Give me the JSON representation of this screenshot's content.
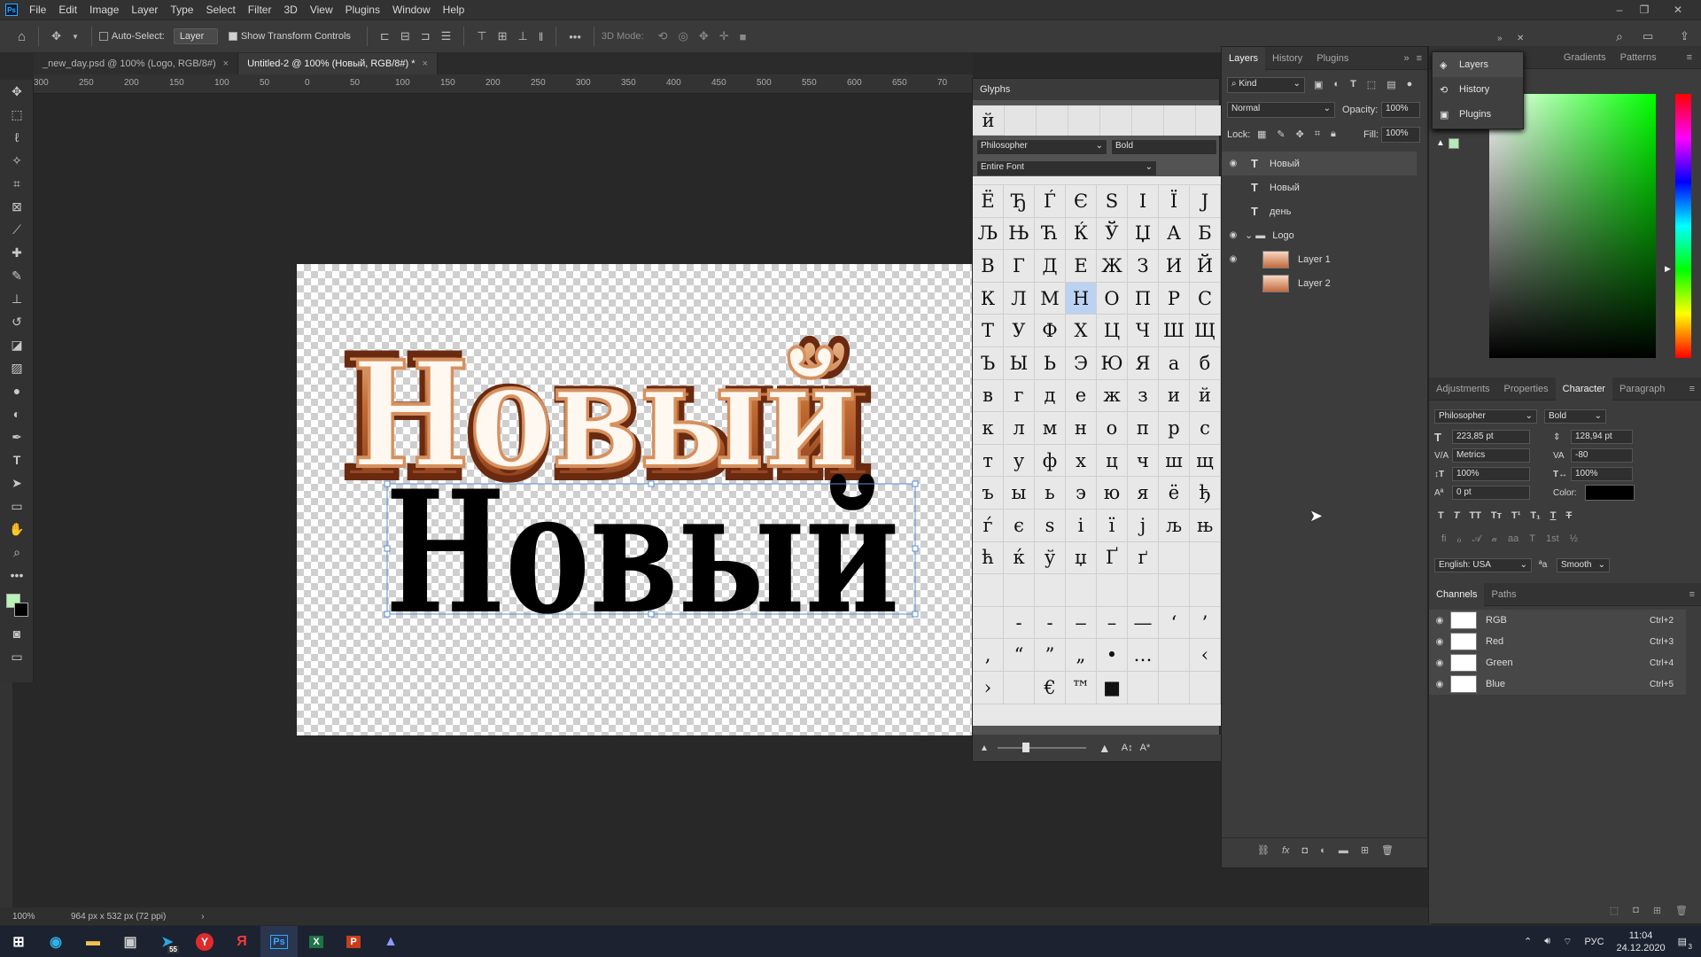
{
  "app": {
    "menu": [
      "File",
      "Edit",
      "Image",
      "Layer",
      "Type",
      "Select",
      "Filter",
      "3D",
      "View",
      "Plugins",
      "Window",
      "Help"
    ],
    "options": {
      "auto_select_label": "Auto-Select:",
      "auto_select_value": "Layer",
      "show_transform_label": "Show Transform Controls",
      "mode_3d_label": "3D Mode:"
    },
    "tabs": [
      {
        "label": "_new_day.psd @ 100% (Logo, RGB/8#)"
      },
      {
        "label": "Untitled-2 @ 100% (Новый, RGB/8#) *"
      }
    ],
    "ruler_ticks": [
      "300",
      "250",
      "200",
      "150",
      "100",
      "50",
      "0",
      "50",
      "100",
      "150",
      "200",
      "250",
      "300",
      "350",
      "400",
      "450",
      "500",
      "550",
      "600",
      "650",
      "70"
    ],
    "status": {
      "zoom": "100%",
      "doc_info": "964 px x 532 px (72 ppi)"
    }
  },
  "canvas": {
    "logo_text": "Новый",
    "black_text": "Новый"
  },
  "glyphs": {
    "title": "Glyphs",
    "recent": "й",
    "font": "Philosopher",
    "style": "Bold",
    "filter": "Entire Font",
    "partial_row": [
      "",
      "",
      "",
      "",
      "",
      "",
      "",
      ""
    ],
    "cells": [
      [
        "Ё",
        "Ђ",
        "Ѓ",
        "Є",
        "S",
        "І",
        "Ї",
        "J"
      ],
      [
        "Љ",
        "Њ",
        "Ћ",
        "Ќ",
        "Ў",
        "Џ",
        "А",
        "Б"
      ],
      [
        "В",
        "Г",
        "Д",
        "Е",
        "Ж",
        "З",
        "И",
        "Й"
      ],
      [
        "К",
        "Л",
        "М",
        "Н",
        "О",
        "П",
        "Р",
        "С"
      ],
      [
        "Т",
        "У",
        "Ф",
        "Х",
        "Ц",
        "Ч",
        "Ш",
        "Щ"
      ],
      [
        "Ъ",
        "Ы",
        "Ь",
        "Э",
        "Ю",
        "Я",
        "а",
        "б"
      ],
      [
        "в",
        "г",
        "д",
        "е",
        "ж",
        "з",
        "и",
        "й"
      ],
      [
        "к",
        "л",
        "м",
        "н",
        "о",
        "п",
        "р",
        "с"
      ],
      [
        "т",
        "у",
        "ф",
        "х",
        "ц",
        "ч",
        "ш",
        "щ"
      ],
      [
        "ъ",
        "ы",
        "ь",
        "э",
        "ю",
        "я",
        "ё",
        "ђ"
      ],
      [
        "ѓ",
        "є",
        "ѕ",
        "і",
        "ї",
        "ј",
        "љ",
        "њ"
      ],
      [
        "ћ",
        "ќ",
        "ў",
        "џ",
        "Ґ",
        "ґ",
        "",
        ""
      ],
      [
        "",
        "",
        "",
        "",
        "",
        "",
        "",
        ""
      ],
      [
        "",
        "‐",
        "‑",
        "‒",
        "–",
        "—",
        "‘",
        "’"
      ],
      [
        "‚",
        "“",
        "”",
        "„",
        "•",
        "…",
        "",
        "‹"
      ],
      [
        "›",
        "",
        "€",
        "™",
        "■",
        "",
        "",
        ""
      ]
    ]
  },
  "layers": {
    "tabs": [
      "Layers",
      "History",
      "Plugins"
    ],
    "kind_label": "Kind",
    "blend_mode": "Normal",
    "opacity_label": "Opacity:",
    "opacity": "100%",
    "lock_label": "Lock:",
    "fill_label": "Fill:",
    "fill": "100%",
    "items": [
      {
        "name": "Новый",
        "type": "text",
        "visible": true
      },
      {
        "name": "Новый",
        "type": "text",
        "visible": false
      },
      {
        "name": "день",
        "type": "text",
        "visible": false
      },
      {
        "name": "Logo",
        "type": "group",
        "visible": true
      },
      {
        "name": "Layer 1",
        "type": "image",
        "visible": true
      },
      {
        "name": "Layer 2",
        "type": "image",
        "visible": false
      }
    ]
  },
  "flyout": [
    "Layers",
    "History",
    "Plugins"
  ],
  "color_panel": {
    "tabs": [
      "Gradients",
      "Patterns"
    ]
  },
  "character": {
    "tabs": [
      "Adjustments",
      "Properties",
      "Character",
      "Paragraph"
    ],
    "font": "Philosopher",
    "style": "Bold",
    "size": "223,85 pt",
    "leading": "128,94 pt",
    "kerning": "Metrics",
    "tracking": "-80",
    "v_scale": "100%",
    "h_scale": "100%",
    "baseline": "0 pt",
    "color_label": "Color:",
    "language": "English: USA",
    "aa_symbol": "ªa",
    "antialias": "Smooth"
  },
  "channels": {
    "tabs": [
      "Channels",
      "Paths"
    ],
    "items": [
      {
        "name": "RGB",
        "shortcut": "Ctrl+2"
      },
      {
        "name": "Red",
        "shortcut": "Ctrl+3"
      },
      {
        "name": "Green",
        "shortcut": "Ctrl+4"
      },
      {
        "name": "Blue",
        "shortcut": "Ctrl+5"
      }
    ]
  },
  "taskbar": {
    "time": "11:04",
    "date": "24.12.2020",
    "lang": "РУС",
    "notifications": "3",
    "telegram_badge": "55"
  }
}
